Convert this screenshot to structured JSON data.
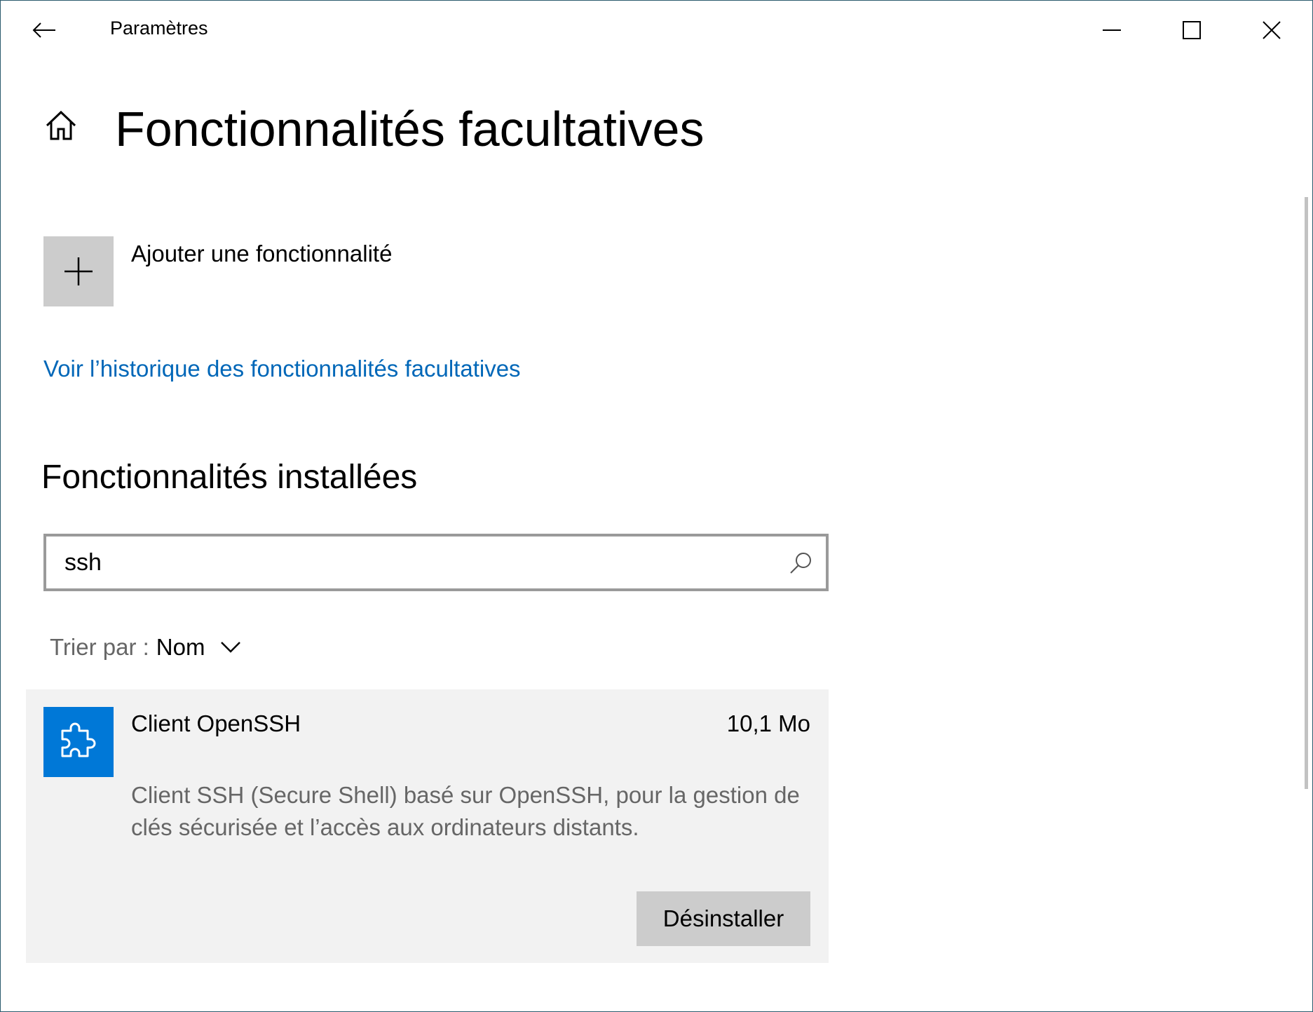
{
  "window": {
    "app_title": "Paramètres"
  },
  "page": {
    "title": "Fonctionnalités facultatives"
  },
  "add_feature": {
    "label": "Ajouter une fonctionnalité"
  },
  "history_link": "Voir l’historique des fonctionnalités facultatives",
  "installed": {
    "section_title": "Fonctionnalités installées",
    "search": {
      "value": "ssh"
    },
    "sort": {
      "label": "Trier par :",
      "value": "Nom"
    },
    "features": [
      {
        "name": "Client OpenSSH",
        "size": "10,1 Mo",
        "description": "Client SSH (Secure Shell) basé sur OpenSSH, pour la gestion de clés sécurisée et l’accès aux ordinateurs distants.",
        "action_label": "Désinstaller",
        "icon": "puzzle-icon"
      }
    ]
  },
  "colors": {
    "accent": "#0078d7",
    "link": "#0067b8",
    "card_bg": "#f2f2f2",
    "button_bg": "#cccccc"
  },
  "icons": [
    "back-arrow-icon",
    "minimize-icon",
    "maximize-icon",
    "close-icon",
    "home-icon",
    "plus-icon",
    "search-icon",
    "chevron-down-icon",
    "puzzle-icon"
  ]
}
